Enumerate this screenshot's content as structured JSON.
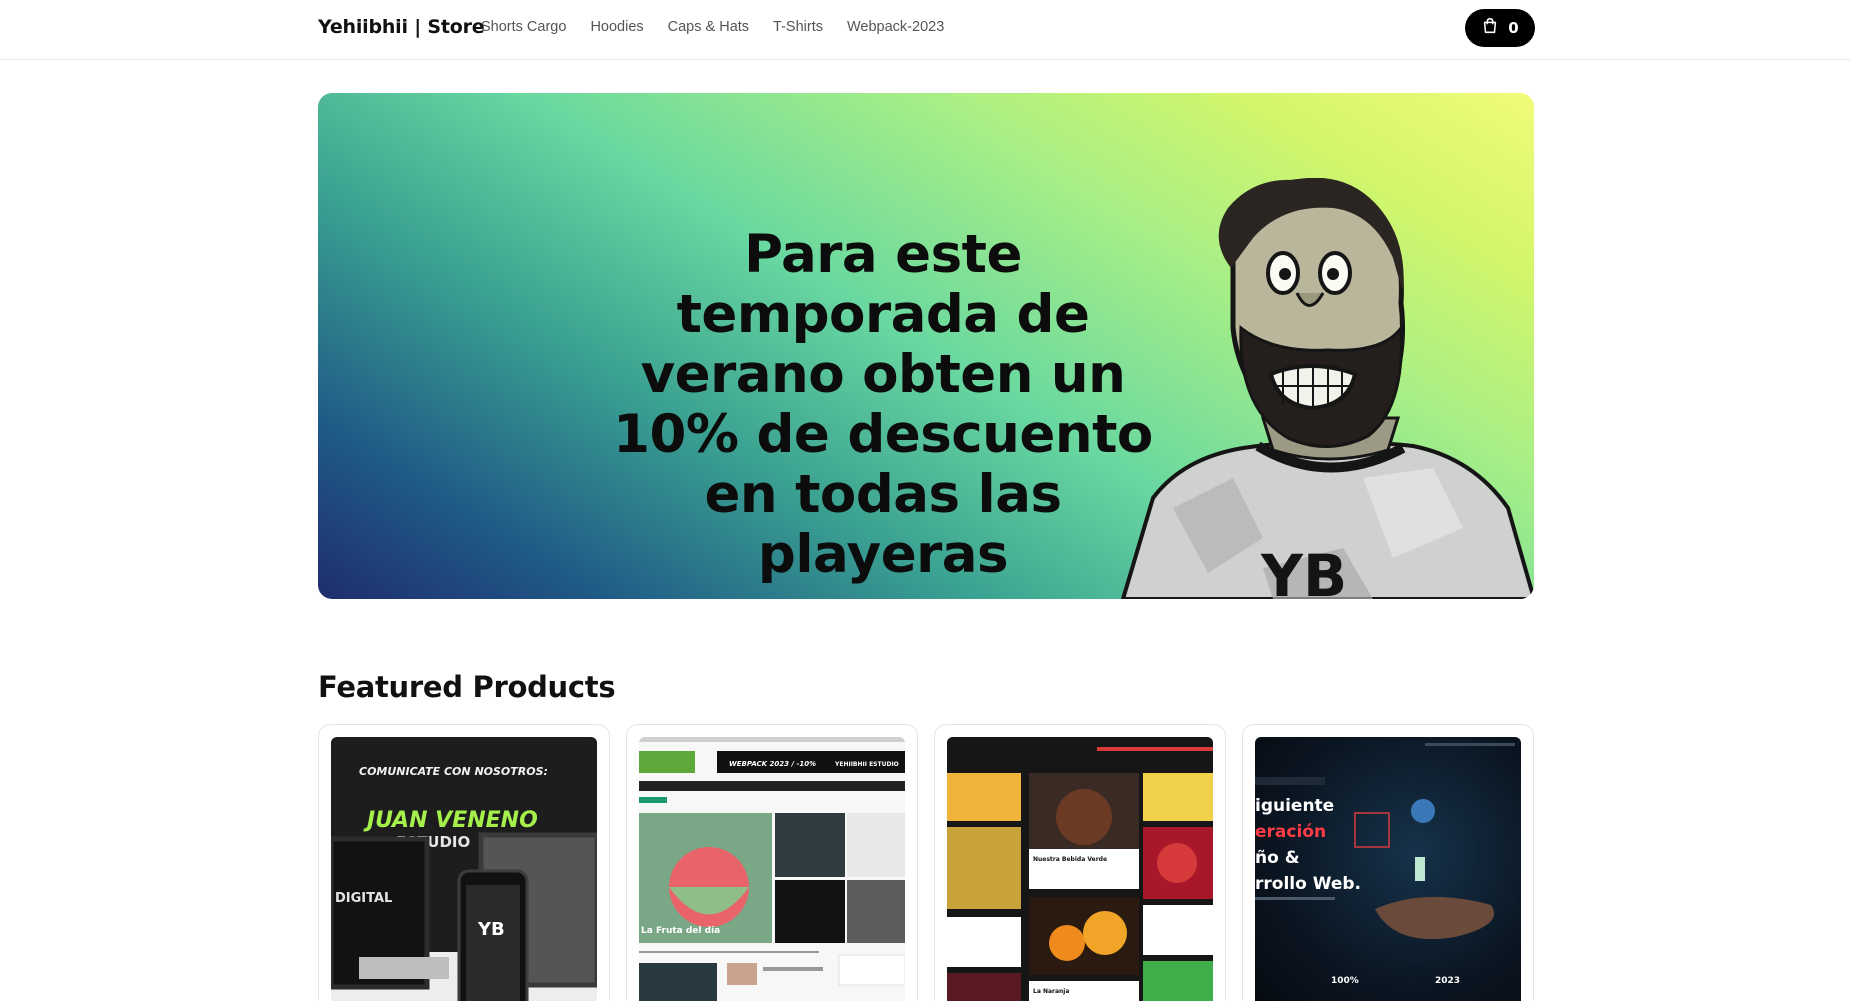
{
  "header": {
    "brand": "Yehiibhii | Store",
    "nav": [
      "Shorts Cargo",
      "Hoodies",
      "Caps & Hats",
      "T-Shirts",
      "Webpack-2023"
    ],
    "cart_count": "0",
    "cart_icon": "shopping-bag-icon"
  },
  "hero": {
    "text": "Para este temporada de verano obten un 10% de descuento en todas las playeras",
    "figure": "cartoon-bearded-man-illustration",
    "logo_text": "YB",
    "colors": {
      "gradient_start": "#1f2d6e",
      "gradient_mid": "#69d8a0",
      "gradient_end": "#f1fb7a"
    }
  },
  "featured": {
    "title": "Featured Products",
    "products": [
      {
        "image": "web-design-devices-mockup",
        "texts": [
          "COMUNICATE CON NOSOTROS:",
          "JUAN VENENO",
          "ESTUDIO",
          "DIGITAL",
          "YB"
        ]
      },
      {
        "image": "news-site-mockup",
        "texts": [
          "WEBPACK 2023 / -10%",
          "YEHIIBHII ESTUDIO",
          "La Fruta del dia"
        ]
      },
      {
        "image": "food-blog-mockup",
        "texts": [
          "Nuestra Bebida Verde",
          "La Naranja"
        ]
      },
      {
        "image": "dark-space-landing-mockup",
        "texts": [
          "iguiente",
          "eración",
          "ño &",
          "rrollo Web.",
          "100%",
          "2023"
        ]
      }
    ]
  }
}
